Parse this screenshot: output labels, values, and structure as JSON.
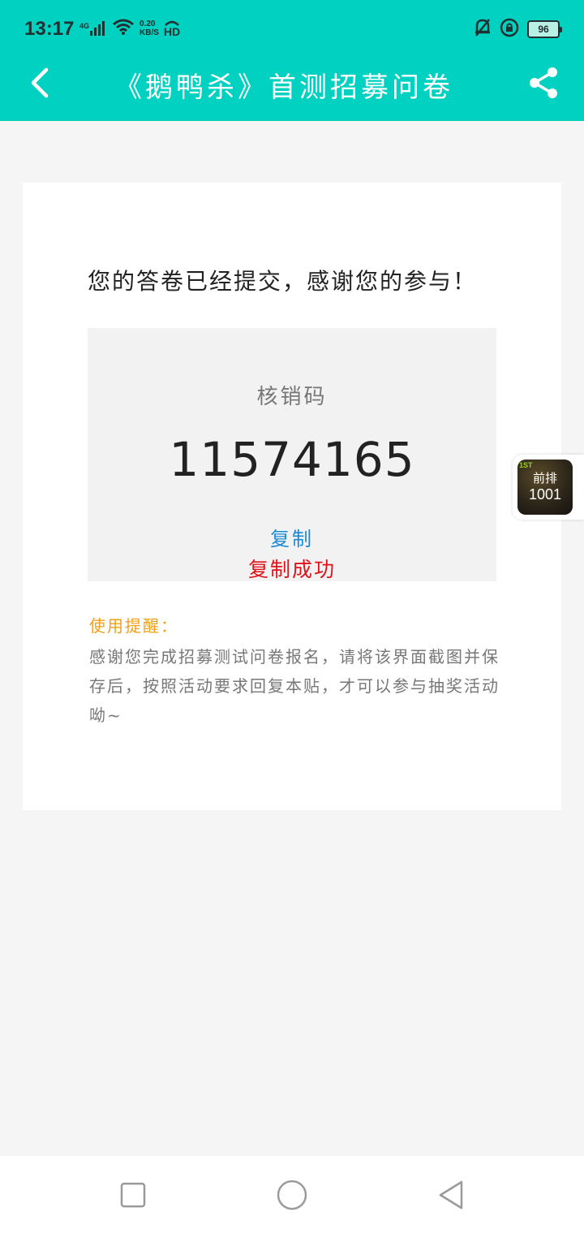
{
  "status_bar": {
    "time": "13:17",
    "network_type": "4G",
    "net_speed_value": "0.20",
    "net_speed_unit": "KB/S",
    "hd_label": "HD",
    "battery_level": "96"
  },
  "header": {
    "title": "《鹅鸭杀》首测招募问卷"
  },
  "card": {
    "success_message": "您的答卷已经提交，感谢您的参与！",
    "code_label": "核销码",
    "code_value": "11574165",
    "copy_label": "复制",
    "copy_status": "复制成功",
    "tip_title": "使用提醒：",
    "tip_text": "感谢您完成招募测试问卷报名，请将该界面截图并保存后，按照活动要求回复本贴，才可以参与抽奖活动呦~"
  },
  "float_widget": {
    "badge": "1ST",
    "line1": "前排",
    "line2": "1001"
  },
  "colors": {
    "header_bg": "#00d1c1",
    "copy_link": "#1a8ad4",
    "copy_status": "#e0131b",
    "tip_title": "#f0a01a"
  },
  "icons": {
    "back": "back-arrow-icon",
    "share": "share-icon",
    "nav_recent": "square-icon",
    "nav_home": "circle-icon",
    "nav_back": "triangle-back-icon"
  }
}
